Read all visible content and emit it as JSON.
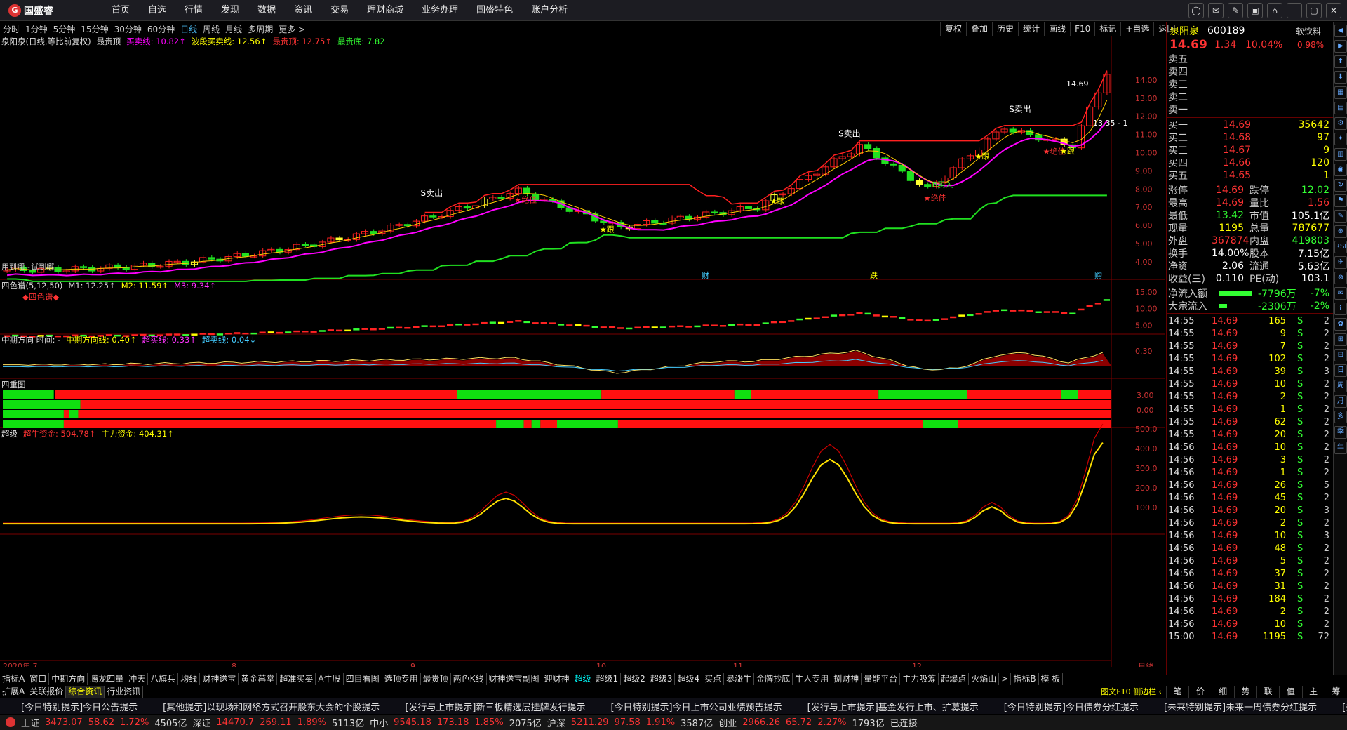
{
  "app": {
    "logo_text": "国盛睿",
    "logo_mark": "G"
  },
  "nav": [
    "首页",
    "自选",
    "行情",
    "发现",
    "数据",
    "资讯",
    "交易",
    "理财商城",
    "业务办理",
    "国盛特色",
    "账户分析"
  ],
  "window_controls": [
    "message-icon",
    "mail-icon",
    "tools-icon",
    "skin-icon",
    "shirt-icon",
    "minimize-icon",
    "maximize-icon",
    "close-icon"
  ],
  "window_control_glyphs": [
    "◯",
    "✉",
    "✎",
    "▣",
    "⌂",
    "–",
    "▢",
    "✕"
  ],
  "periods": [
    "分时",
    "1分钟",
    "5分钟",
    "15分钟",
    "30分钟",
    "60分钟",
    "日线",
    "周线",
    "月线",
    "多周期",
    "更多 >"
  ],
  "active_period": "日线",
  "right_buttons": [
    "复权",
    "叠加",
    "历史",
    "统计",
    "画线",
    "F10",
    "标记",
    "+自选",
    "返回"
  ],
  "main_panel": {
    "title": "泉阳泉(日线,等比前复权)",
    "indicator": "最贵顶",
    "buy_line": "买卖线: 10.82↑",
    "wave": "波段买卖线: 12.56↑",
    "top": "最贵顶: 12.75↑",
    "bottom": "最贵底: 7.82",
    "sell_top": "S卖出",
    "buy_mark": "B买入",
    "follow": "跟",
    "best": "★绝佳",
    "hint": "用到哪~试到哪",
    "max_label": "14.69",
    "last_label": "13.35 - 1",
    "markers": [
      "财",
      "跌",
      "购"
    ]
  },
  "y_axis_main": [
    "14.00",
    "13.00",
    "12.00",
    "11.00",
    "10.00",
    "9.00",
    "8.00",
    "7.00",
    "6.00",
    "5.00",
    "4.00"
  ],
  "panel2": {
    "title": "四色谱(5,12,50)",
    "m1": "M1: 12.25↑",
    "m2": "M2: 11.59↑",
    "m3": "M3: 9.34↑",
    "label": "◆四色谱◆",
    "y": [
      "15.00",
      "10.00",
      "5.00"
    ]
  },
  "panel3": {
    "title": "中期方向 时间: -",
    "dir": "中期方向线: 0.40↑",
    "buy": "超买线: 0.33↑",
    "sell": "超卖线: 0.04↓",
    "y": [
      "0.30"
    ]
  },
  "panel4": {
    "title": "四重图",
    "y": [
      "3.00",
      "0.00"
    ]
  },
  "panel5": {
    "title": "超级",
    "fund1": "超牛资金: 504.78↑",
    "fund2": "主力资金: 404.31↑",
    "y": [
      "500.0",
      "400.0",
      "300.0",
      "200.0",
      "100.0"
    ]
  },
  "x_axis": [
    "2020年 7",
    "8",
    "9",
    "10",
    "11",
    "12",
    "日线"
  ],
  "tabs_row1": [
    "指标A",
    "窗口",
    "中期方向",
    "腾龙四量",
    "冲天",
    "八旗兵",
    "均线",
    "财神送宝",
    "黄金苒堂",
    "超准买卖",
    "A牛股",
    "四目看图",
    "选顶专用",
    "最贵顶",
    "两色K线",
    "财神送宝副图",
    "迎财神",
    "超级",
    "超级1",
    "超级2",
    "超级3",
    "超级4",
    "买点",
    "暴涨牛",
    "金牌抄底",
    "牛人专用",
    "捌财神",
    "量能平台",
    "主力吸筹",
    "起爆点",
    "火焰山",
    ">",
    "指标B",
    "模 板"
  ],
  "tabs_row1_active": "超级",
  "tabs_row2": [
    "扩展A",
    "关联报价",
    "综合资讯",
    "行业资讯"
  ],
  "tabs_row2_active": "综合资讯",
  "quote": {
    "name": "泉阳泉",
    "code": "600189",
    "sector": "软饮料",
    "sector_pct": "0.98%",
    "price": "14.69",
    "change": "1.34",
    "pct": "10.04%",
    "asks": [
      {
        "l": "卖五",
        "p": "",
        "v": ""
      },
      {
        "l": "卖四",
        "p": "",
        "v": ""
      },
      {
        "l": "卖三",
        "p": "",
        "v": ""
      },
      {
        "l": "卖二",
        "p": "",
        "v": ""
      },
      {
        "l": "卖一",
        "p": "",
        "v": ""
      }
    ],
    "bids": [
      {
        "l": "买一",
        "p": "14.69",
        "v": "35642"
      },
      {
        "l": "买二",
        "p": "14.68",
        "v": "97"
      },
      {
        "l": "买三",
        "p": "14.67",
        "v": "9"
      },
      {
        "l": "买四",
        "p": "14.66",
        "v": "120"
      },
      {
        "l": "买五",
        "p": "14.65",
        "v": "1"
      }
    ],
    "stats": [
      [
        "涨停",
        "14.69",
        "跌停",
        "12.02"
      ],
      [
        "最高",
        "14.69",
        "量比",
        "1.56"
      ],
      [
        "最低",
        "13.42",
        "市值",
        "105.1亿"
      ],
      [
        "现量",
        "1195",
        "总量",
        "787677"
      ],
      [
        "外盘",
        "367874",
        "内盘",
        "419803"
      ],
      [
        "换手",
        "14.00%",
        "股本",
        "7.15亿"
      ],
      [
        "净资",
        "2.06",
        "流通",
        "5.63亿"
      ],
      [
        "收益(三)",
        "0.110",
        "PE(动)",
        "103.1"
      ]
    ],
    "flows": [
      {
        "l": "净流入额",
        "v": "-7796万",
        "p": "-7%"
      },
      {
        "l": "大宗流入",
        "v": "-2306万",
        "p": "-2%"
      }
    ],
    "ticks": [
      [
        "14:55",
        "14.69",
        "165",
        "S",
        "2"
      ],
      [
        "14:55",
        "14.69",
        "9",
        "S",
        "2"
      ],
      [
        "14:55",
        "14.69",
        "7",
        "S",
        "2"
      ],
      [
        "14:55",
        "14.69",
        "102",
        "S",
        "2"
      ],
      [
        "14:55",
        "14.69",
        "39",
        "S",
        "3"
      ],
      [
        "14:55",
        "14.69",
        "10",
        "S",
        "2"
      ],
      [
        "14:55",
        "14.69",
        "2",
        "S",
        "2"
      ],
      [
        "14:55",
        "14.69",
        "1",
        "S",
        "2"
      ],
      [
        "14:55",
        "14.69",
        "62",
        "S",
        "2"
      ],
      [
        "14:55",
        "14.69",
        "20",
        "S",
        "2"
      ],
      [
        "14:56",
        "14.69",
        "10",
        "S",
        "2"
      ],
      [
        "14:56",
        "14.69",
        "3",
        "S",
        "2"
      ],
      [
        "14:56",
        "14.69",
        "1",
        "S",
        "2"
      ],
      [
        "14:56",
        "14.69",
        "26",
        "S",
        "5"
      ],
      [
        "14:56",
        "14.69",
        "45",
        "S",
        "2"
      ],
      [
        "14:56",
        "14.69",
        "20",
        "S",
        "3"
      ],
      [
        "14:56",
        "14.69",
        "2",
        "S",
        "2"
      ],
      [
        "14:56",
        "14.69",
        "10",
        "S",
        "3"
      ],
      [
        "14:56",
        "14.69",
        "48",
        "S",
        "2"
      ],
      [
        "14:56",
        "14.69",
        "5",
        "S",
        "2"
      ],
      [
        "14:56",
        "14.69",
        "37",
        "S",
        "2"
      ],
      [
        "14:56",
        "14.69",
        "31",
        "S",
        "2"
      ],
      [
        "14:56",
        "14.69",
        "184",
        "S",
        "2"
      ],
      [
        "14:56",
        "14.69",
        "2",
        "S",
        "2"
      ],
      [
        "14:56",
        "14.69",
        "10",
        "S",
        "2"
      ],
      [
        "15:00",
        "14.69",
        "1195",
        "S",
        "72"
      ]
    ]
  },
  "quote_tabs": [
    "笔",
    "价",
    "细",
    "势",
    "联",
    "值",
    "主",
    "筹"
  ],
  "quote_tabs_extra": "图文F10 侧边栏 ‹",
  "side_tools": [
    "◀",
    "▶",
    "⬆",
    "⬇",
    "▦",
    "▤",
    "⚙",
    "✦",
    "▥",
    "◉",
    "↻",
    "⚑",
    "✎",
    "⊕",
    "RSI",
    "✈",
    "⊗",
    "✉",
    "ℹ",
    "✿",
    "⊞",
    "⊟",
    "日",
    "周",
    "月",
    "多",
    "季",
    "年"
  ],
  "news": [
    "[今日特别提示]今日公告提示",
    "[其他提示]以现场和网络方式召开股东大会的个股提示",
    "[发行与上市提示]新三板精选层挂牌发行提示",
    "[今日特别提示]今日上市公司业绩预告提示",
    "[发行与上市提示]基金发行上市、扩募提示",
    "[今日特别提示]今日债券分红提示",
    "[未来特别提示]未来一周债券分红提示",
    "[未来特别"
  ],
  "status": {
    "sh_label": "上证",
    "sh": "3473.07",
    "sh_chg": "58.62",
    "sh_pct": "1.72%",
    "sh_amt": "4505亿",
    "sz_label": "深证",
    "sz": "14470.7",
    "sz_chg": "269.11",
    "sz_pct": "1.89%",
    "sz_amt": "5113亿",
    "zx_label": "中小",
    "zx": "9545.18",
    "zx_chg": "173.18",
    "zx_pct": "1.85%",
    "zx_amt": "2075亿",
    "hs_label": "沪深",
    "hs": "5211.29",
    "hs_chg": "97.58",
    "hs_pct": "1.91%",
    "hs_amt": "3587亿",
    "cy_label": "创业",
    "cy": "2966.26",
    "cy_chg": "65.72",
    "cy_pct": "2.27%",
    "cy_amt": "1793亿",
    "conn": "已连接"
  },
  "colors": {
    "up": "#ff2020",
    "down": "#20e020",
    "yellow": "#ffff00",
    "magenta": "#ff00ff",
    "cyan": "#00c8ff",
    "bg": "#000000"
  }
}
